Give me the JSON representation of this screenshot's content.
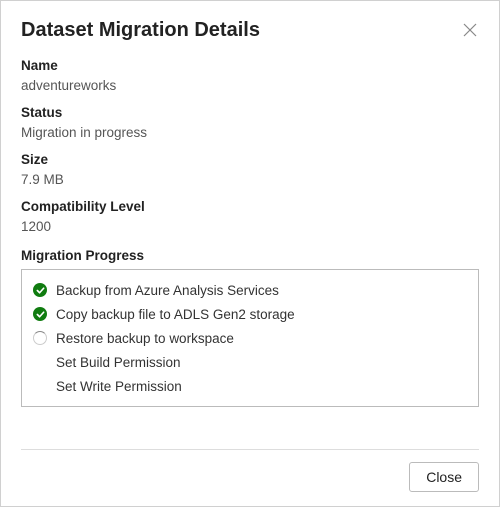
{
  "dialog": {
    "title": "Dataset Migration Details",
    "close_button_label": "Close"
  },
  "fields": {
    "name": {
      "label": "Name",
      "value": "adventureworks"
    },
    "status": {
      "label": "Status",
      "value": "Migration in progress"
    },
    "size": {
      "label": "Size",
      "value": "7.9 MB"
    },
    "compat": {
      "label": "Compatibility Level",
      "value": "1200"
    }
  },
  "progress": {
    "section_label": "Migration Progress",
    "steps": [
      {
        "label": "Backup from Azure Analysis Services",
        "state": "done"
      },
      {
        "label": "Copy backup file to ADLS Gen2 storage",
        "state": "done"
      },
      {
        "label": "Restore backup to workspace",
        "state": "running"
      },
      {
        "label": "Set Build Permission",
        "state": "pending"
      },
      {
        "label": "Set Write Permission",
        "state": "pending"
      }
    ]
  }
}
